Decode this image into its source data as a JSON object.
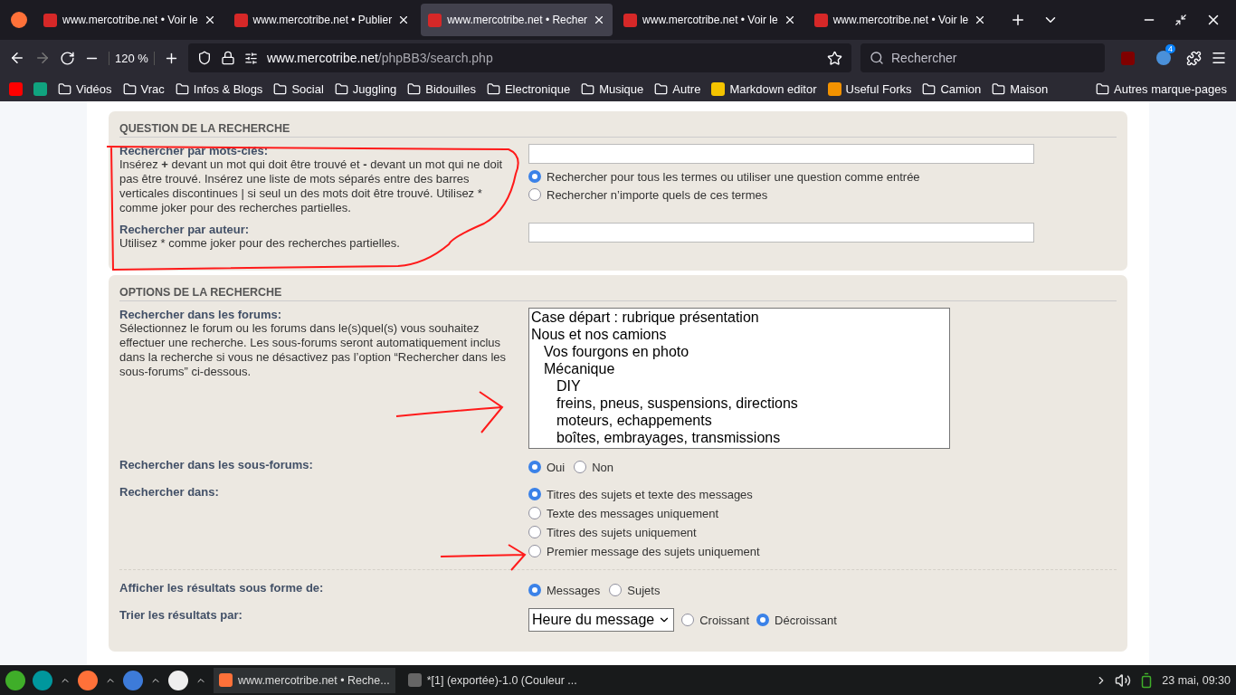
{
  "browser": {
    "tabs": [
      {
        "title": "www.mercotribe.net • Voir le",
        "selected": false
      },
      {
        "title": "www.mercotribe.net • Publier",
        "selected": false
      },
      {
        "title": "www.mercotribe.net • Recher",
        "selected": true
      },
      {
        "title": "www.mercotribe.net • Voir le",
        "selected": false
      },
      {
        "title": "www.mercotribe.net • Voir le",
        "selected": false
      }
    ],
    "zoom": "120 %",
    "url_host": "www.mercotribe.net",
    "url_path": "/phpBB3/search.php",
    "search_placeholder": "Rechercher",
    "extension_badge": "4",
    "bookmarks": [
      {
        "kind": "video"
      },
      {
        "kind": "chat"
      },
      {
        "kind": "folder",
        "label": "Vidéos"
      },
      {
        "kind": "folder",
        "label": "Vrac"
      },
      {
        "kind": "folder",
        "label": "Infos & Blogs"
      },
      {
        "kind": "folder",
        "label": "Social"
      },
      {
        "kind": "folder",
        "label": "Juggling"
      },
      {
        "kind": "folder",
        "label": "Bidouilles"
      },
      {
        "kind": "folder",
        "label": "Electronique"
      },
      {
        "kind": "folder",
        "label": "Musique"
      },
      {
        "kind": "folder",
        "label": "Autre"
      },
      {
        "kind": "markdown",
        "label": "Markdown editor"
      },
      {
        "kind": "forks",
        "label": "Useful Forks"
      },
      {
        "kind": "folder",
        "label": "Camion"
      },
      {
        "kind": "folder",
        "label": "Maison"
      }
    ],
    "other_bookmarks": "Autres marque-pages"
  },
  "query_panel": {
    "heading": "QUESTION DE LA RECHERCHE",
    "keywords": {
      "label": "Rechercher par mots-clés:",
      "help": "Insérez **+** devant un mot qui doit être trouvé et **-** devant un mot qui ne doit pas être trouvé. Insérez une liste de mots séparés entre des barres verticales discontinues | si seul un des mots doit être trouvé. Utilisez * comme joker pour des recherches partielles.",
      "options": [
        {
          "label": "Rechercher pour tous les termes ou utiliser une question comme entrée",
          "selected": true
        },
        {
          "label": "Rechercher n’importe quels de ces termes",
          "selected": false
        }
      ]
    },
    "author": {
      "label": "Rechercher par auteur:",
      "help": "Utilisez * comme joker pour des recherches partielles."
    }
  },
  "options_panel": {
    "heading": "OPTIONS DE LA RECHERCHE",
    "forums": {
      "label": "Rechercher dans les forums:",
      "help": "Sélectionnez le forum ou les forums dans le(s)quel(s) vous souhaitez effectuer une recherche. Les sous-forums seront automatiquement inclus dans la recherche si vous ne désactivez pas l’option “Rechercher dans les sous-forums” ci-dessous.",
      "list": [
        {
          "label": "Case départ : rubrique présentation"
        },
        {
          "label": "Nous et nos camions",
          "children": [
            {
              "label": "Vos fourgons en photo"
            },
            {
              "label": "Mécanique",
              "children": [
                {
                  "label": "DIY"
                },
                {
                  "label": "freins, pneus, suspensions, directions"
                },
                {
                  "label": "moteurs, echappements"
                },
                {
                  "label": "boîtes, embrayages, transmissions"
                }
              ]
            }
          ]
        }
      ]
    },
    "rows": [
      {
        "label": "Rechercher dans les sous-forums:",
        "options": [
          {
            "label": "Oui",
            "selected": true
          },
          {
            "label": "Non",
            "selected": false
          }
        ]
      },
      {
        "label": "Rechercher dans:",
        "options": [
          {
            "label": "Titres des sujets et texte des messages",
            "selected": true
          },
          {
            "label": "Texte des messages uniquement",
            "selected": false
          },
          {
            "label": "Titres des sujets uniquement",
            "selected": false
          },
          {
            "label": "Premier message des sujets uniquement",
            "selected": false
          }
        ]
      }
    ],
    "display": {
      "label": "Afficher les résultats sous forme de:",
      "options": [
        {
          "label": "Messages",
          "selected": true
        },
        {
          "label": "Sujets",
          "selected": false
        }
      ]
    },
    "sort": {
      "label": "Trier les résultats par:",
      "value": "Heure du message",
      "options": [
        {
          "label": "Croissant",
          "selected": false
        },
        {
          "label": "Décroissant",
          "selected": true
        }
      ]
    }
  },
  "taskbar": {
    "windows": [
      {
        "label": "www.mercotribe.net • Reche...",
        "selected": true
      },
      {
        "label": "*[1] (exportée)-1.0 (Couleur ...",
        "selected": false
      }
    ],
    "clock": "23 mai, 09:30"
  }
}
